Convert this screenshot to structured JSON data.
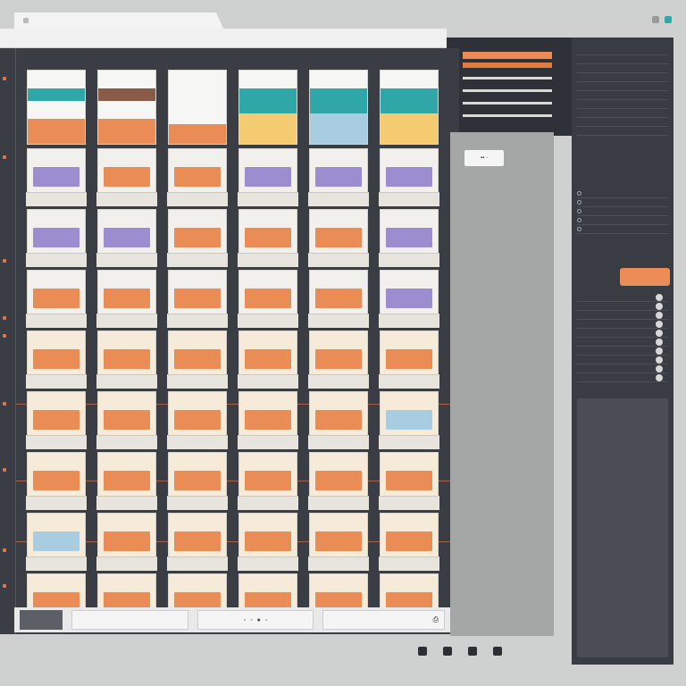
{
  "tab": {
    "label": ""
  },
  "urlbar": {
    "title": ""
  },
  "colors": {
    "orange": "#ea8c55",
    "teal": "#2fa7a8",
    "purple": "#9b8dd0",
    "yellow": "#f5cb72",
    "lightblue": "#a9cde0",
    "brown": "#8a5b47",
    "dark_bg": "#3a3d44",
    "panel_bg": "#393c43"
  },
  "columns": [
    {
      "header": [
        "white",
        "teal",
        "white",
        "orange"
      ],
      "cards": [
        "purple",
        "purple",
        "orange",
        "orange",
        "orange",
        "orange",
        "lightblue",
        "orange"
      ]
    },
    {
      "header": [
        "white",
        "brown",
        "white",
        "orange"
      ],
      "cards": [
        "orange",
        "purple",
        "orange",
        "orange",
        "orange",
        "orange",
        "orange",
        "orange"
      ]
    },
    {
      "header": [
        "white",
        "white",
        "white",
        "orange"
      ],
      "cards": [
        "orange",
        "orange",
        "orange",
        "orange",
        "orange",
        "orange",
        "orange",
        "orange"
      ]
    },
    {
      "header": [
        "white",
        "teal",
        "teal",
        "yellow"
      ],
      "cards": [
        "purple",
        "orange",
        "orange",
        "orange",
        "orange",
        "orange",
        "orange",
        "orange"
      ]
    },
    {
      "header": [
        "white",
        "teal",
        "teal",
        "lightblue"
      ],
      "cards": [
        "purple",
        "orange",
        "orange",
        "orange",
        "orange",
        "orange",
        "orange",
        "orange"
      ]
    },
    {
      "header": [
        "white",
        "teal",
        "teal",
        "yellow"
      ],
      "cards": [
        "purple",
        "purple",
        "purple",
        "orange",
        "lightblue",
        "orange",
        "orange",
        "orange"
      ]
    }
  ],
  "panel": {
    "button_label": ""
  },
  "bottombar": {
    "controls": [
      "",
      "",
      "",
      ""
    ]
  }
}
